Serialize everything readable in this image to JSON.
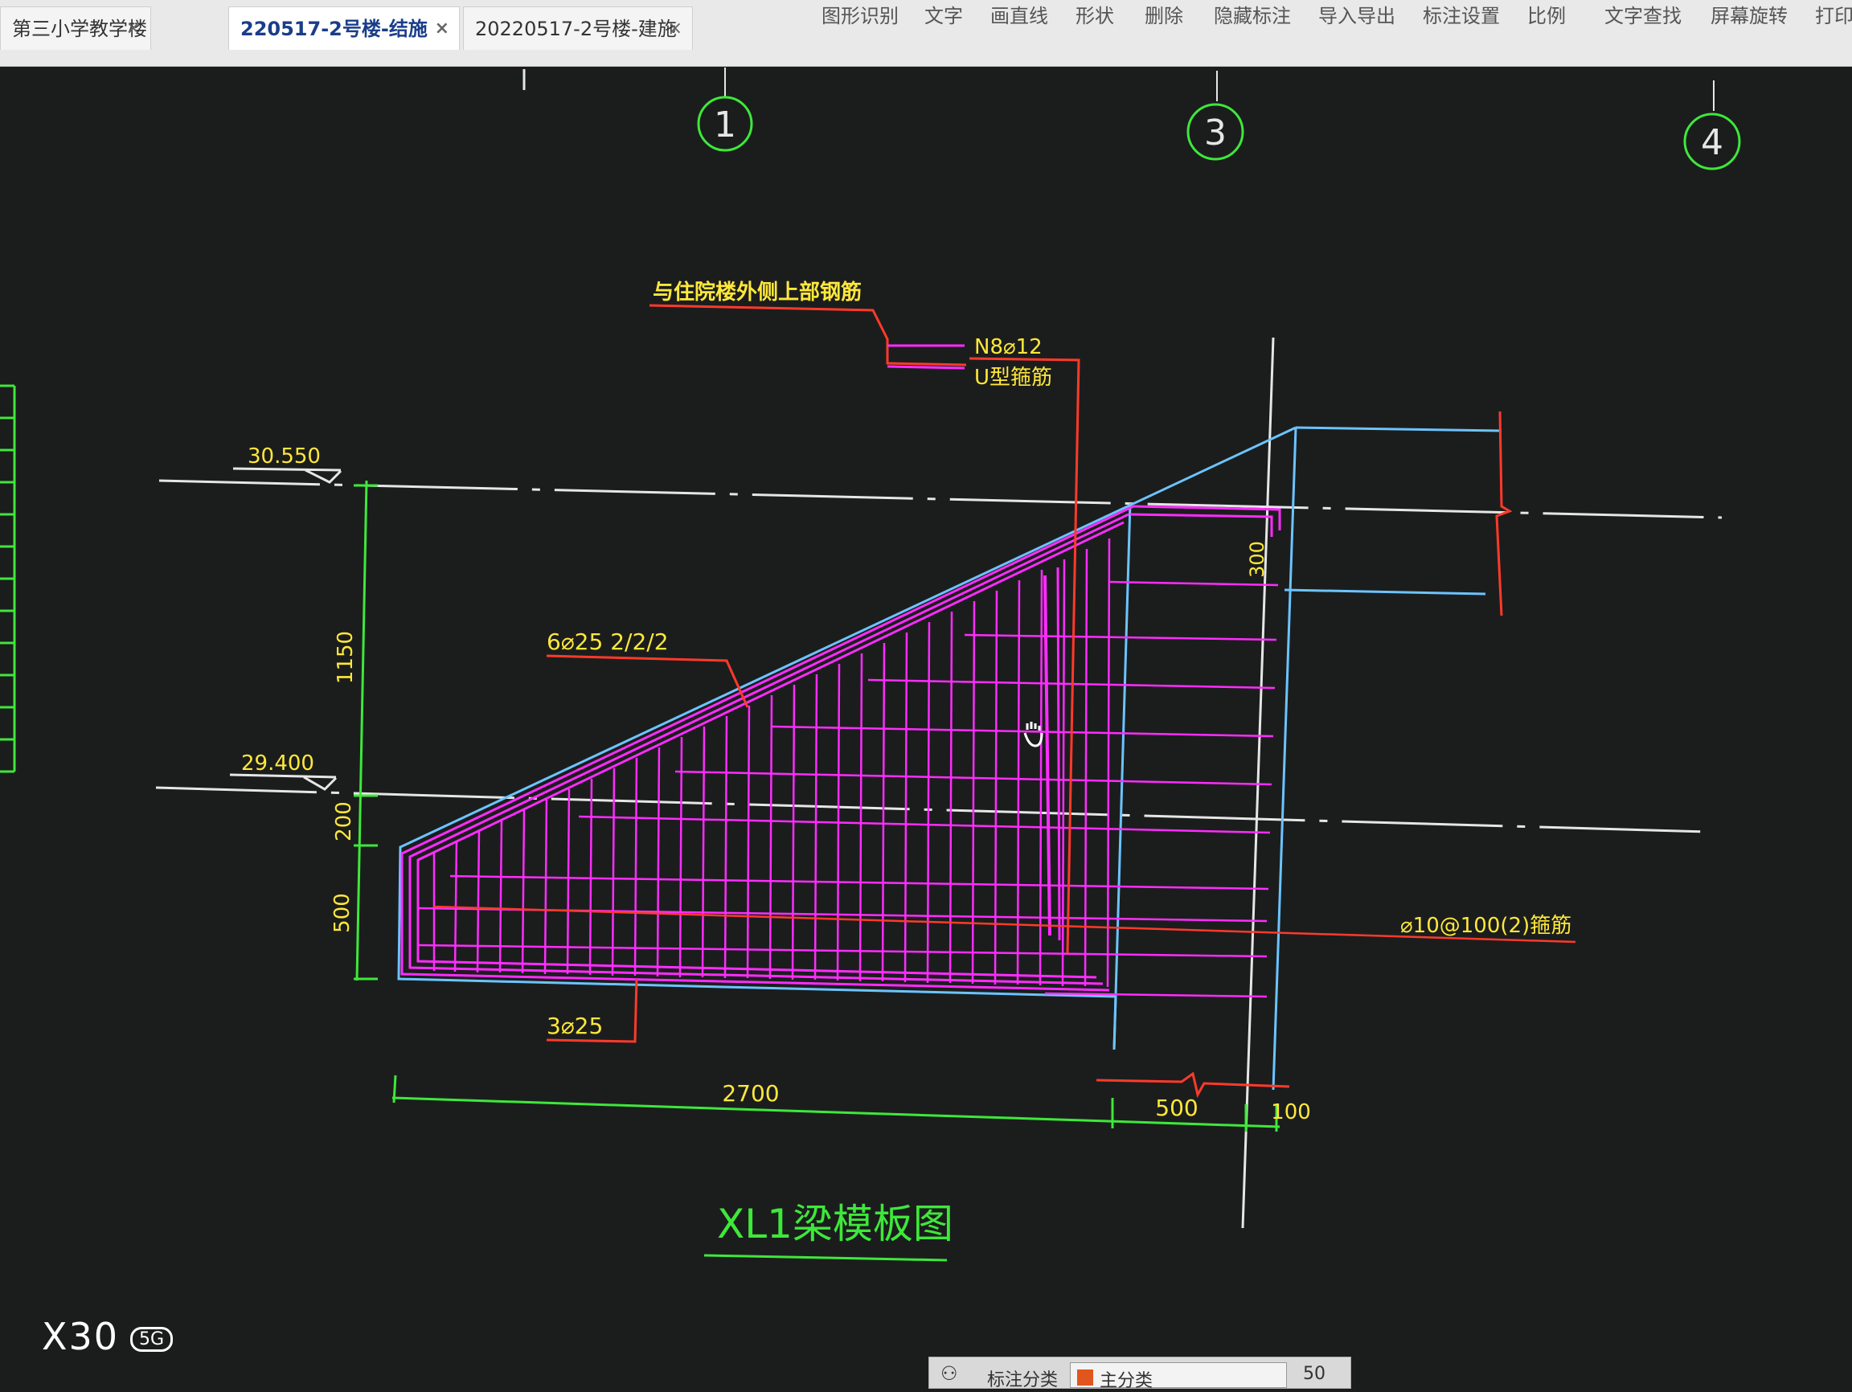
{
  "tabs": [
    {
      "label": "第三小学教学楼（图审…",
      "active": false
    },
    {
      "label": "220517-2号楼-结施",
      "active": true
    },
    {
      "label": "20220517-2号楼-建施",
      "active": false
    }
  ],
  "tab_close_glyph": "×",
  "menu": [
    "图形识别",
    "文字",
    "画直线",
    "形状",
    "删除",
    "隐藏标注",
    "导入导出",
    "标注设置",
    "比例",
    "文字查找",
    "屏幕旋转",
    "打印"
  ],
  "drawing": {
    "axis_labels": [
      "1",
      "3",
      "4"
    ],
    "elevations": [
      "30.550",
      "29.400"
    ],
    "dimensions": {
      "v1": "1150",
      "v2": "200",
      "v3": "500",
      "h1": "2700",
      "h2": "500",
      "h3": "100",
      "right_v": "300"
    },
    "notes": {
      "top_note": "与住院楼外侧上部钢筋",
      "n_bar": "N8⌀12",
      "u_bar": "U型箍筋",
      "top_bar": "6⌀25 2/2/2",
      "bottom_bar": "3⌀25",
      "stirrup": "⌀10@100(2)箍筋"
    },
    "title": "XL1梁模板图"
  },
  "status": {
    "label": "标注分类",
    "value": "主分类",
    "icon": "group-icon",
    "extra": "50"
  },
  "watermark": {
    "brand": "X30",
    "badge": "5G"
  },
  "colors": {
    "background": "#1b1d1d",
    "green": "#3ee83a",
    "magenta": "#ff2cff",
    "blue": "#6cc4ff",
    "red": "#ff3a2a",
    "yellow": "#ffe83a",
    "white": "#e6e6e6"
  }
}
